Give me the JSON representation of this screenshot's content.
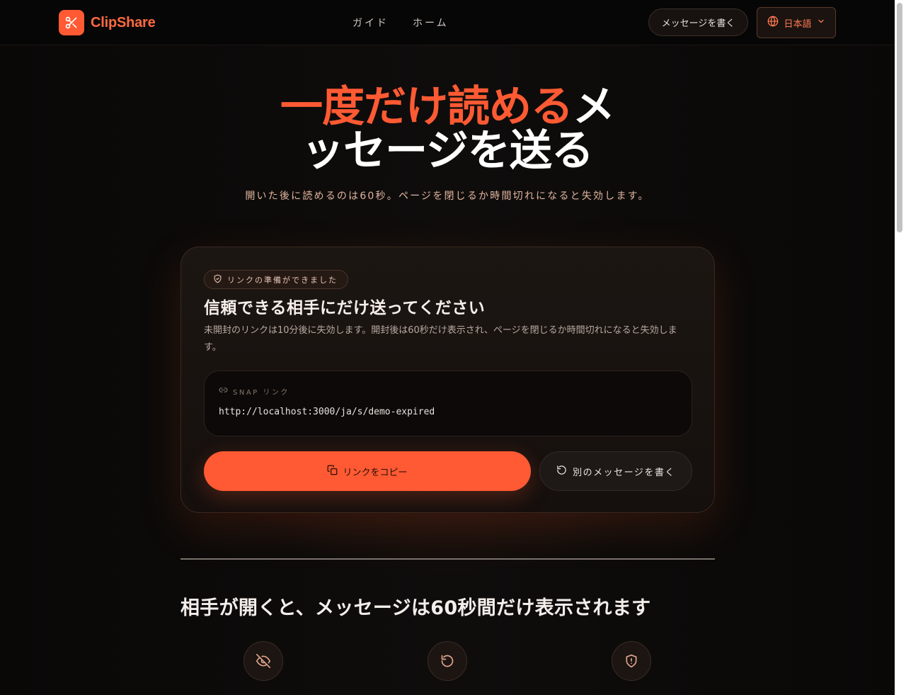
{
  "header": {
    "brand_name": "ClipShare",
    "nav": [
      "ガイド",
      "ホーム"
    ],
    "compose_label": "メッセージを書く",
    "language_label": "日本語"
  },
  "hero": {
    "title_accent": "一度だけ読める",
    "title_rest_line1": "メ",
    "title_line2": "ッセージを送る",
    "subtitle": "開いた後に読めるのは60秒。ページを閉じるか時間切れになると失効します。"
  },
  "card": {
    "badge": "リンクの準備ができました",
    "title": "信頼できる相手にだけ送ってください",
    "description": "未開封のリンクは10分後に失効します。開封後は60秒だけ表示され、ページを閉じるか時間切れになると失効します。",
    "link_label": "SNAP リンク",
    "link_url": "http://localhost:3000/ja/s/demo-expired",
    "copy_label": "リンクをコピー",
    "new_label": "別のメッセージを書く"
  },
  "section": {
    "title": "相手が開くと、メッセージは60秒間だけ表示されます"
  },
  "colors": {
    "accent": "#ff5a33",
    "background": "#0b0908"
  },
  "icons": [
    "scissors-icon",
    "globe-icon",
    "chevron-down-icon",
    "shield-icon",
    "link-icon",
    "copy-icon",
    "refresh-icon",
    "eye-off-icon",
    "rotate-icon",
    "shield-alert-icon"
  ]
}
